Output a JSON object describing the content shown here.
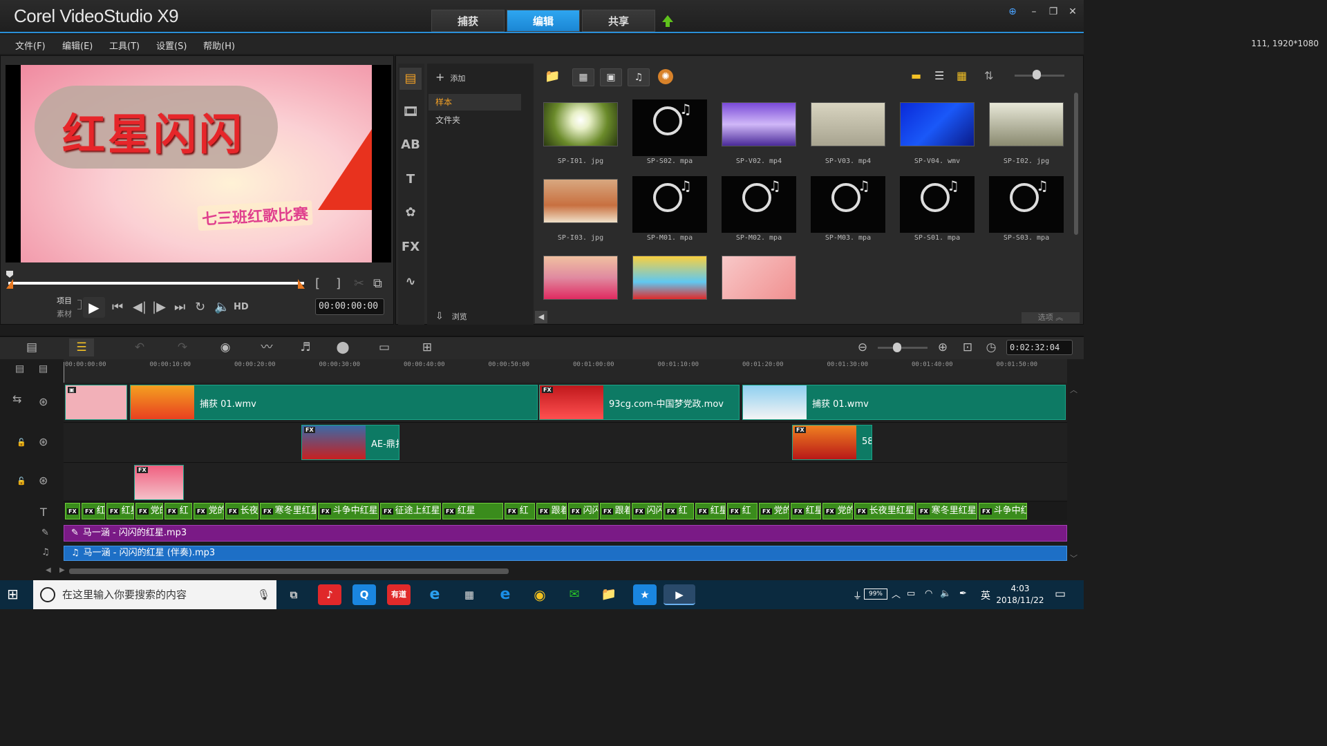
{
  "app": {
    "title": "Corel VideoStudio X9"
  },
  "tabs": [
    {
      "label": "捕获"
    },
    {
      "label": "编辑"
    },
    {
      "label": "共享"
    }
  ],
  "menu": [
    {
      "label": "文件(F)"
    },
    {
      "label": "编辑(E)"
    },
    {
      "label": "工具(T)"
    },
    {
      "label": "设置(S)"
    },
    {
      "label": "帮助(H)"
    }
  ],
  "project_info": "111, 1920*1080",
  "preview": {
    "title_text": "红星闪闪",
    "subtitle_text": "七三班红歌比赛",
    "mode_project": "项目",
    "mode_clip": "素材",
    "hd": "HD",
    "timecode": "00:00:00:00"
  },
  "library": {
    "add_label": "添加",
    "folders": [
      {
        "label": "样本"
      },
      {
        "label": "文件夹"
      }
    ],
    "browse_label": "浏览",
    "options_label": "选项",
    "items": [
      {
        "caption": "SP-I01. jpg",
        "kind": "image"
      },
      {
        "caption": "SP-S02. mpa",
        "kind": "audio"
      },
      {
        "caption": "SP-V02. mp4",
        "kind": "video"
      },
      {
        "caption": "SP-V03. mp4",
        "kind": "video"
      },
      {
        "caption": "SP-V04. wmv",
        "kind": "video"
      },
      {
        "caption": "SP-I02. jpg",
        "kind": "image"
      },
      {
        "caption": "SP-I03. jpg",
        "kind": "image"
      },
      {
        "caption": "SP-M01. mpa",
        "kind": "audio"
      },
      {
        "caption": "SP-M02. mpa",
        "kind": "audio"
      },
      {
        "caption": "SP-M03. mpa",
        "kind": "audio"
      },
      {
        "caption": "SP-S01. mpa",
        "kind": "audio"
      },
      {
        "caption": "SP-S03. mpa",
        "kind": "audio"
      },
      {
        "caption": "",
        "kind": "image"
      },
      {
        "caption": "",
        "kind": "image"
      },
      {
        "caption": "",
        "kind": "video"
      }
    ]
  },
  "timeline": {
    "timecode": "0:02:32:04",
    "ruler": [
      "00:00:00:00",
      "00:00:10:00",
      "00:00:20:00",
      "00:00:30:00",
      "00:00:40:00",
      "00:00:50:00",
      "00:01:00:00",
      "00:01:10:00",
      "00:01:20:00",
      "00:01:30:00",
      "00:01:40:00",
      "00:01:50:00"
    ],
    "video_clips": [
      {
        "label": "捕获 01.wmv"
      },
      {
        "label": "93cg.com-中国梦党政.mov"
      },
      {
        "label": "捕获 01.wmv"
      }
    ],
    "overlay1_clips": [
      {
        "label": "AE-鼎扌"
      },
      {
        "label": "58("
      }
    ],
    "title_clips": [
      "红",
      "红星",
      "红星",
      "党的",
      "红",
      "党的",
      "长夜里红星",
      "寒冬里红星",
      "斗争中红星",
      "征途上红星",
      "红星",
      "红",
      "跟着",
      "闪闪",
      "跟着",
      "闪闪",
      "红",
      "红星",
      "红",
      "党的",
      "红星",
      "党的",
      "长夜里红星",
      "寒冬里红星",
      "斗争中红"
    ],
    "voice_clip": "马一涵 - 闪闪的红星.mp3",
    "music_clip": "马一涵 - 闪闪的红星 (伴奏).mp3"
  },
  "taskbar": {
    "search_placeholder": "在这里输入你要搜索的内容",
    "battery": "99%",
    "ime": "英",
    "time": "4:03",
    "date": "2018/11/22"
  },
  "colors": {
    "accent": "#2a8fd8",
    "video_track": "#0d7a64",
    "title_track": "#3a8c1c",
    "voice_track": "#7a1a86",
    "music_track": "#1d6fc6"
  }
}
